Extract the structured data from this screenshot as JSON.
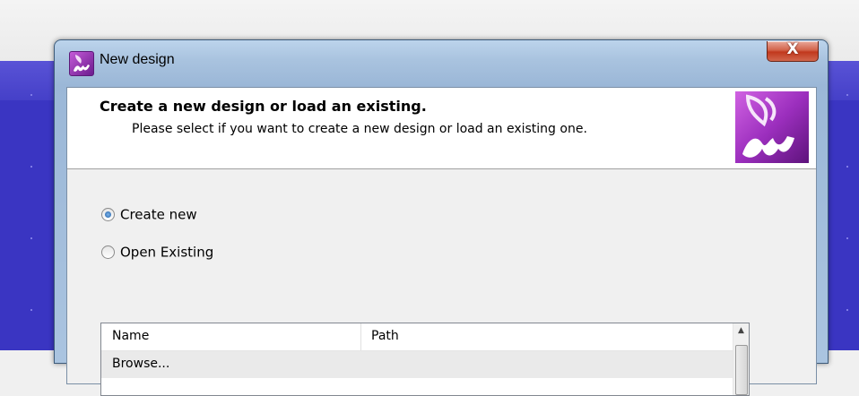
{
  "window": {
    "title": "New design",
    "close_label": "X"
  },
  "banner": {
    "title": "Create a new design or load an existing.",
    "subtitle": "Please select if you want to create a new design or load an existing one."
  },
  "options": [
    {
      "label": "Create new",
      "checked": true
    },
    {
      "label": "Open Existing",
      "checked": false
    }
  ],
  "list": {
    "columns": [
      "Name",
      "Path"
    ],
    "rows": [
      {
        "name": "Browse...",
        "path": ""
      }
    ]
  },
  "colors": {
    "accent": "#9c2fbe",
    "background_app": "#3a35c2"
  },
  "icons": [
    "app-logo-icon",
    "close-icon",
    "scroll-up-arrow-icon"
  ]
}
